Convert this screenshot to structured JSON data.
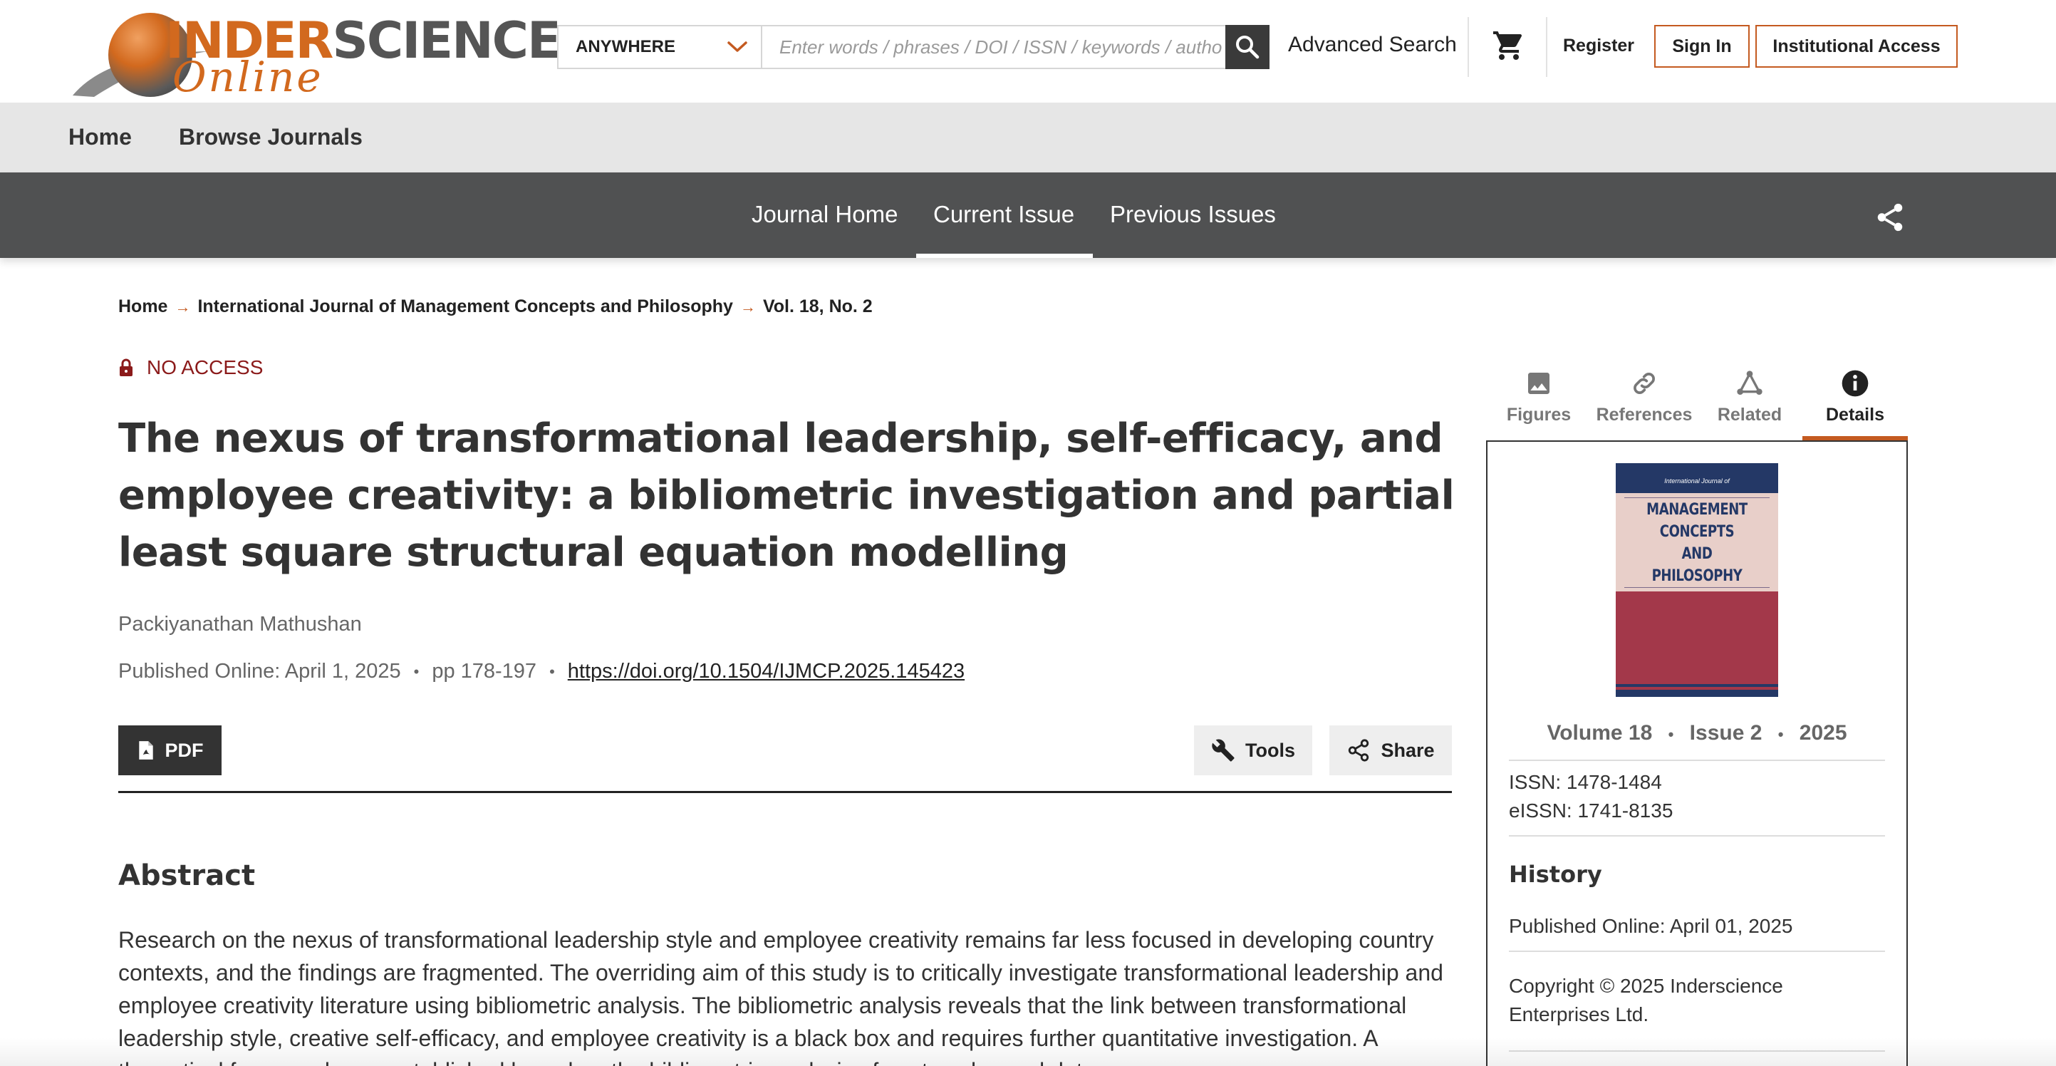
{
  "header": {
    "logo_brand_part1": "INDER",
    "logo_brand_part2": "SCIENCE",
    "logo_online": "Online",
    "search_scope": "ANYWHERE",
    "search_placeholder": "Enter words / phrases / DOI / ISSN / keywords / autho",
    "advanced_search": "Advanced Search",
    "register": "Register",
    "sign_in": "Sign In",
    "institutional_access": "Institutional Access"
  },
  "nav": {
    "home": "Home",
    "browse_journals": "Browse Journals"
  },
  "journal_nav": {
    "journal_home": "Journal Home",
    "current_issue": "Current Issue",
    "previous_issues": "Previous Issues"
  },
  "breadcrumb": {
    "home": "Home",
    "journal": "International Journal of Management Concepts and Philosophy",
    "issue": "Vol. 18, No. 2"
  },
  "article": {
    "access_status": "NO ACCESS",
    "title": "The nexus of transformational leadership, self-efficacy, and employee creativity: a bibliometric investigation and partial least square structural equation modelling",
    "author": "Packiyanathan Mathushan",
    "published": "Published Online: April 1, 2025",
    "pages": "pp 178-197",
    "doi": "https://doi.org/10.1504/IJMCP.2025.145423",
    "pdf_label": "PDF",
    "tools_label": "Tools",
    "share_label": "Share",
    "abstract_heading": "Abstract",
    "abstract_text": "Research on the nexus of transformational leadership style and employee creativity remains far less focused in developing country contexts, and the findings are fragmented. The overriding aim of this study is to critically investigate transformational leadership and employee creativity literature using bibliometric analysis. The bibliometric analysis reveals that the link between transformational leadership style, creative self-efficacy, and employee creativity is a black box and requires further quantitative investigation. A theoretical framework was established based on the bibliometric analysis of past works, and data"
  },
  "sidebar": {
    "tabs": [
      {
        "label": "Figures",
        "icon": "image-icon"
      },
      {
        "label": "References",
        "icon": "link-icon"
      },
      {
        "label": "Related",
        "icon": "related-icon"
      },
      {
        "label": "Details",
        "icon": "info-icon"
      }
    ],
    "cover_small": "International Journal of",
    "cover_line1": "MANAGEMENT",
    "cover_line2": "CONCEPTS",
    "cover_line3": "AND",
    "cover_line4": "PHILOSOPHY",
    "volume": "Volume 18",
    "issue": "Issue 2",
    "year": "2025",
    "issn": "ISSN: 1478-1484",
    "eissn": "eISSN: 1741-8135",
    "history_heading": "History",
    "history_published": "Published Online: April 01, 2025",
    "copyright": "Copyright © 2025 Inderscience Enterprises Ltd."
  },
  "colors": {
    "accent_orange": "#c45a20",
    "dark_bar": "#505152",
    "no_access_red": "#8b1a1a"
  }
}
